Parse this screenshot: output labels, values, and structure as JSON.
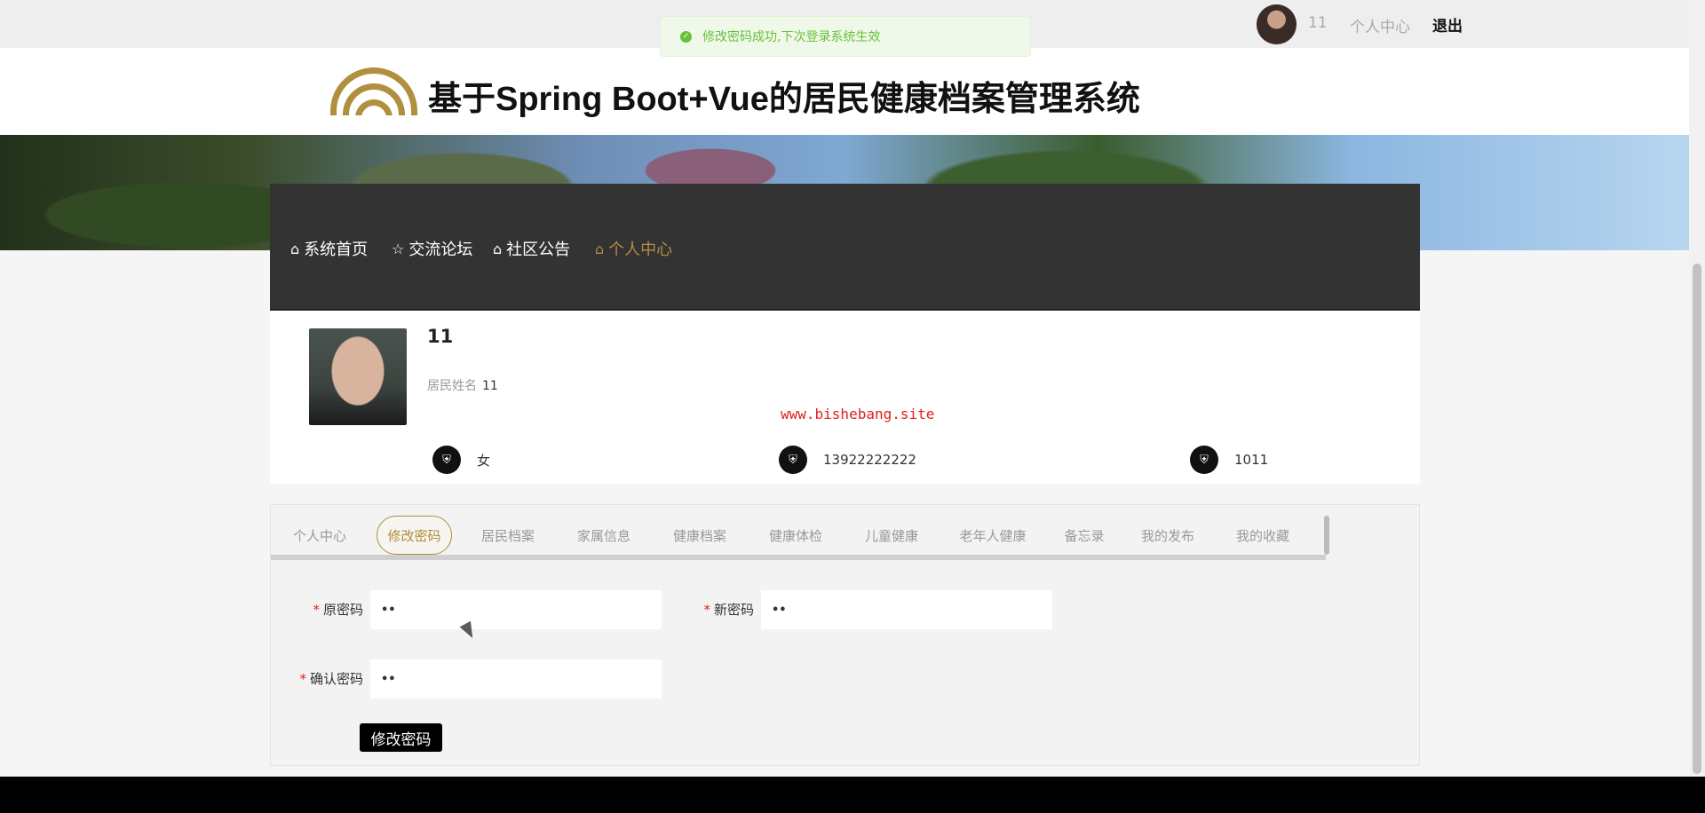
{
  "topbar": {
    "username": "11",
    "center_link": "个人中心",
    "logout": "退出"
  },
  "toast": {
    "message": "修改密码成功,下次登录系统生效",
    "icon": "check-circle-icon"
  },
  "header": {
    "title": "基于Spring Boot+Vue的居民健康档案管理系统"
  },
  "nav": {
    "items": [
      {
        "label": "系统首页",
        "icon": "home-icon"
      },
      {
        "label": "交流论坛",
        "icon": "star-icon"
      },
      {
        "label": "社区公告",
        "icon": "bag-icon"
      },
      {
        "label": "个人中心",
        "icon": "home-icon",
        "active": true
      }
    ]
  },
  "profile": {
    "name": "11",
    "field_label": "居民姓名",
    "field_value": "11",
    "watermark": "www.bishebang.site",
    "gender": "女",
    "phone": "13922222222",
    "id_number": "1011"
  },
  "tabs": [
    {
      "label": "个人中心"
    },
    {
      "label": "修改密码",
      "active": true
    },
    {
      "label": "居民档案"
    },
    {
      "label": "家属信息"
    },
    {
      "label": "健康档案"
    },
    {
      "label": "健康体检"
    },
    {
      "label": "儿童健康"
    },
    {
      "label": "老年人健康"
    },
    {
      "label": "备忘录"
    },
    {
      "label": "我的发布"
    },
    {
      "label": "我的收藏"
    }
  ],
  "form": {
    "required_mark": "*",
    "old_password_label": "原密码",
    "old_password_value": "••",
    "new_password_label": "新密码",
    "new_password_value": "••",
    "confirm_password_label": "确认密码",
    "confirm_password_value": "••",
    "submit_label": "修改密码"
  },
  "colors": {
    "accent": "#b08f3e",
    "nav_bg": "#333333",
    "success": "#67c23a",
    "required": "#e0201b"
  }
}
